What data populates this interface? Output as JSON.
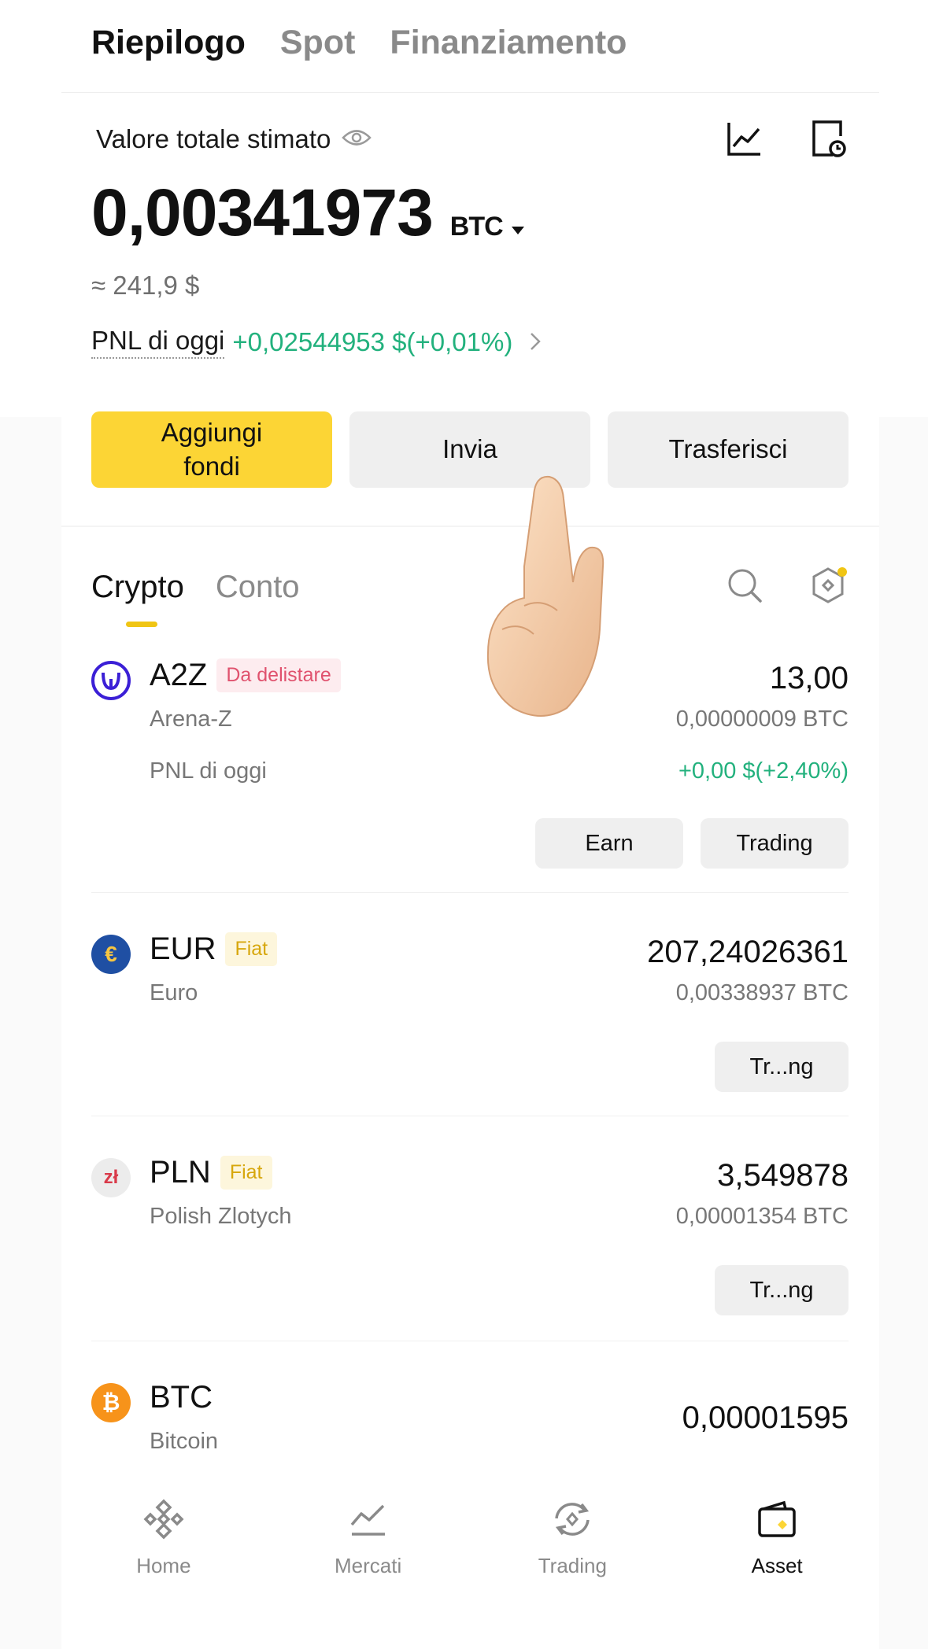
{
  "top_tabs": [
    {
      "label": "Riepilogo",
      "active": true
    },
    {
      "label": "Spot",
      "active": false
    },
    {
      "label": "Finanziamento",
      "active": false
    }
  ],
  "summary": {
    "total_label": "Valore totale stimato",
    "total_value": "0,00341973",
    "unit": "BTC",
    "approx_usd": "≈ 241,9 $",
    "pnl_label": "PNL di oggi",
    "pnl_value": "+0,02544953 $(+0,01%)"
  },
  "actions": {
    "add_funds": "Aggiungi fondi",
    "send": "Invia",
    "transfer": "Trasferisci"
  },
  "sub_tabs": [
    {
      "label": "Crypto",
      "active": true
    },
    {
      "label": "Conto",
      "active": false
    }
  ],
  "assets": [
    {
      "symbol": "A2Z",
      "tag": "Da delistare",
      "name": "Arena-Z",
      "amount": "13,00",
      "btc_value": "0,00000009 BTC",
      "pnl_label": "PNL di oggi",
      "pnl_value": "+0,00 $(+2,40%)",
      "buttons": [
        "Earn",
        "Trading"
      ],
      "icon_color": "#3b1fd6"
    },
    {
      "symbol": "EUR",
      "tag": "Fiat",
      "name": "Euro",
      "amount": "207,24026361",
      "btc_value": "0,00338937 BTC",
      "buttons": [
        "Tr...ng"
      ],
      "icon_color": "#1f4fa3",
      "icon_glyph": "€"
    },
    {
      "symbol": "PLN",
      "tag": "Fiat",
      "name": "Polish Zlotych",
      "amount": "3,549878",
      "btc_value": "0,00001354 BTC",
      "buttons": [
        "Tr...ng"
      ],
      "icon_color": "#e8e8e8",
      "icon_glyph": "zł"
    },
    {
      "symbol": "BTC",
      "name": "Bitcoin",
      "amount": "0,00001595",
      "icon_color": "#f7931a",
      "icon_glyph": "₿"
    }
  ],
  "bottom_nav": [
    {
      "label": "Home",
      "icon": "binance-logo-icon",
      "active": false
    },
    {
      "label": "Mercati",
      "icon": "market-chart-icon",
      "active": false
    },
    {
      "label": "Trading",
      "icon": "trading-swap-icon",
      "active": false
    },
    {
      "label": "Asset",
      "icon": "wallet-icon",
      "active": true
    }
  ],
  "colors": {
    "accent_yellow": "#fcd535",
    "positive_green": "#22b17d",
    "delist_red": "#e0526e",
    "fiat_gold": "#d7a70d"
  }
}
